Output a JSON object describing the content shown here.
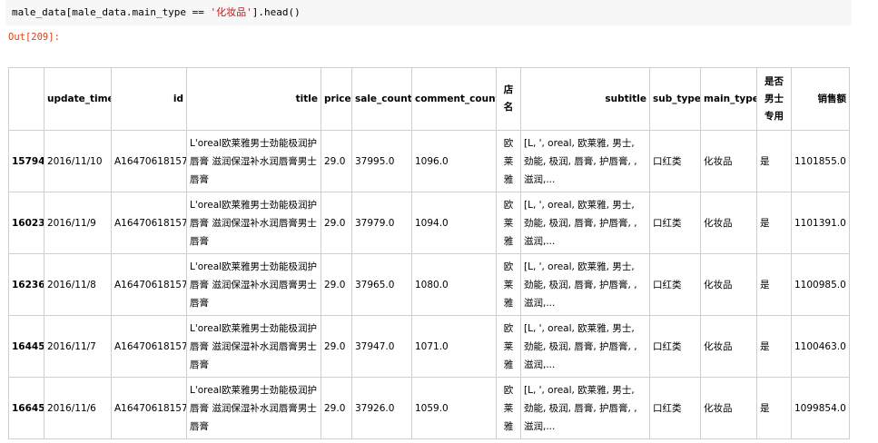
{
  "code": {
    "prefix": "male_data[male_data.main_type == ",
    "string": "'化妆品'",
    "suffix": "].head()"
  },
  "output": {
    "prompt": "Out[209]:"
  },
  "table": {
    "columns": {
      "index": "",
      "update_time": "update_time",
      "id": "id",
      "title": "title",
      "price": "price",
      "sale_count": "sale_count",
      "comment_count": "comment_count",
      "shop": "店名",
      "subtitle": "subtitle",
      "sub_type": "sub_type",
      "main_type": "main_type",
      "male_only": "是否男士专用",
      "sales": "销售额"
    },
    "rows": [
      {
        "index": "15794",
        "update_time": "2016/11/10",
        "id": "A16470618157",
        "title": "L'oreal欧莱雅男士劲能极润护唇膏 滋润保湿补水润唇膏男士唇膏",
        "price": "29.0",
        "sale_count": "37995.0",
        "comment_count": "1096.0",
        "shop": "欧莱雅",
        "subtitle": "[L, ', oreal, 欧莱雅, 男士, 劲能, 极润, 唇膏, 护唇膏, , 滋润,...",
        "sub_type": "口红类",
        "main_type": "化妆品",
        "male_only": "是",
        "sales": "1101855.0"
      },
      {
        "index": "16023",
        "update_time": "2016/11/9",
        "id": "A16470618157",
        "title": "L'oreal欧莱雅男士劲能极润护唇膏 滋润保湿补水润唇膏男士唇膏",
        "price": "29.0",
        "sale_count": "37979.0",
        "comment_count": "1094.0",
        "shop": "欧莱雅",
        "subtitle": "[L, ', oreal, 欧莱雅, 男士, 劲能, 极润, 唇膏, 护唇膏, , 滋润,...",
        "sub_type": "口红类",
        "main_type": "化妆品",
        "male_only": "是",
        "sales": "1101391.0"
      },
      {
        "index": "16236",
        "update_time": "2016/11/8",
        "id": "A16470618157",
        "title": "L'oreal欧莱雅男士劲能极润护唇膏 滋润保湿补水润唇膏男士唇膏",
        "price": "29.0",
        "sale_count": "37965.0",
        "comment_count": "1080.0",
        "shop": "欧莱雅",
        "subtitle": "[L, ', oreal, 欧莱雅, 男士, 劲能, 极润, 唇膏, 护唇膏, , 滋润,...",
        "sub_type": "口红类",
        "main_type": "化妆品",
        "male_only": "是",
        "sales": "1100985.0"
      },
      {
        "index": "16445",
        "update_time": "2016/11/7",
        "id": "A16470618157",
        "title": "L'oreal欧莱雅男士劲能极润护唇膏 滋润保湿补水润唇膏男士唇膏",
        "price": "29.0",
        "sale_count": "37947.0",
        "comment_count": "1071.0",
        "shop": "欧莱雅",
        "subtitle": "[L, ', oreal, 欧莱雅, 男士, 劲能, 极润, 唇膏, 护唇膏, , 滋润,...",
        "sub_type": "口红类",
        "main_type": "化妆品",
        "male_only": "是",
        "sales": "1100463.0"
      },
      {
        "index": "16645",
        "update_time": "2016/11/6",
        "id": "A16470618157",
        "title": "L'oreal欧莱雅男士劲能极润护唇膏 滋润保湿补水润唇膏男士唇膏",
        "price": "29.0",
        "sale_count": "37926.0",
        "comment_count": "1059.0",
        "shop": "欧莱雅",
        "subtitle": "[L, ', oreal, 欧莱雅, 男士, 劲能, 极润, 唇膏, 护唇膏, , 滋润,...",
        "sub_type": "口红类",
        "main_type": "化妆品",
        "male_only": "是",
        "sales": "1099854.0"
      }
    ]
  }
}
